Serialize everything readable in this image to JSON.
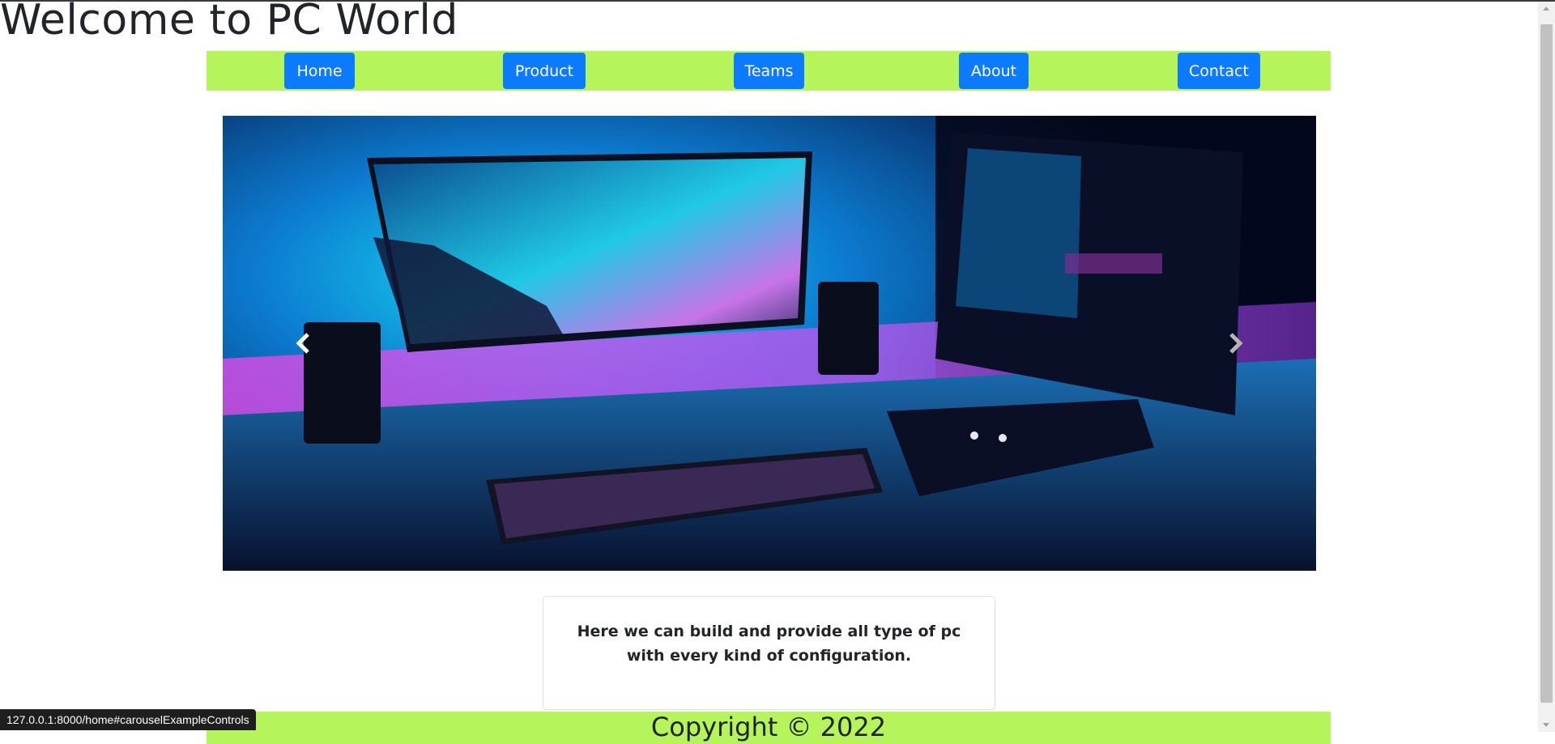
{
  "header": {
    "title": "Welcome to PC World"
  },
  "nav": {
    "items": [
      {
        "label": "Home"
      },
      {
        "label": "Product"
      },
      {
        "label": "Teams"
      },
      {
        "label": "About"
      },
      {
        "label": "Contact"
      }
    ],
    "bar_color": "#b5f55b",
    "button_color": "#0d7bff"
  },
  "carousel": {
    "image_description_icon": "gaming-pc-desk-image",
    "prev_icon": "chevron-left-icon",
    "next_icon": "chevron-right-icon"
  },
  "info_card": {
    "text": "Here we can build and provide all type of pc with every kind of configuration."
  },
  "footer": {
    "text": "Copyright © 2022"
  },
  "status_bar": {
    "url": "127.0.0.1:8000/home#carouselExampleControls"
  }
}
